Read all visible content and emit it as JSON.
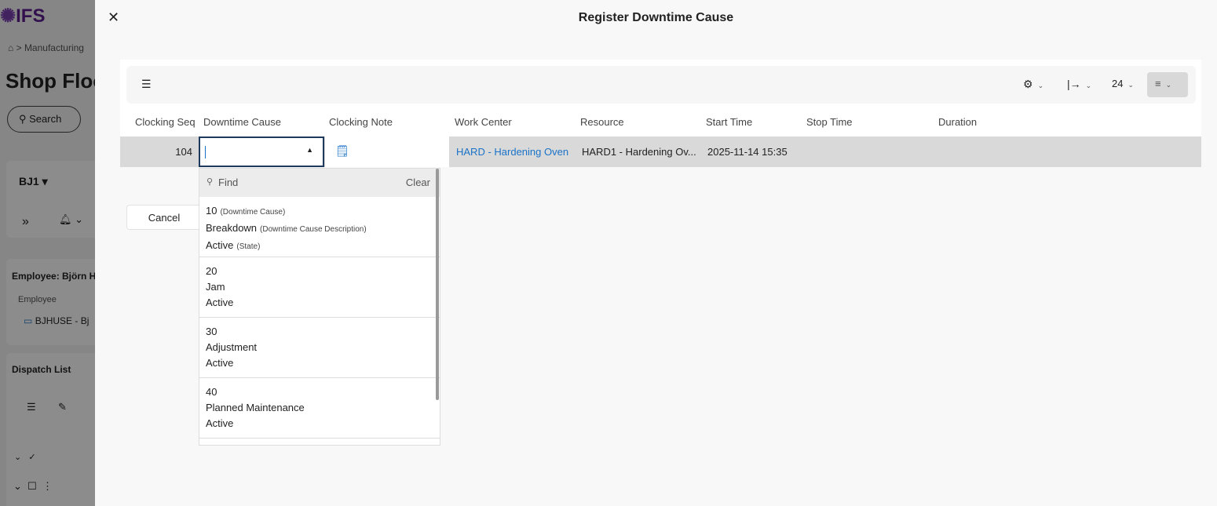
{
  "background": {
    "logo": "IFS",
    "breadcrumb": "Manufacturing",
    "page_title": "Shop Floor",
    "search_label": "Search",
    "resource": "BJ1",
    "employee_title": "Employee: Björn H",
    "employee_label": "Employee",
    "employee_value": "BJHUSE - Bj",
    "dispatch_title": "Dispatch List"
  },
  "modal": {
    "title": "Register Downtime Cause",
    "cancel_label": "Cancel",
    "toolbar": {
      "page_size": "24"
    },
    "columns": [
      "Clocking Seq",
      "Downtime Cause",
      "Clocking Note",
      "Work Center",
      "Resource",
      "Start Time",
      "Stop Time",
      "Duration"
    ],
    "row": {
      "clocking_seq": "104",
      "downtime_cause": "",
      "work_center": "HARD - Hardening Oven",
      "resource": "HARD1 - Hardening Ov...",
      "start_time": "2025-11-14 15:35",
      "stop_time": "",
      "duration": ""
    },
    "dropdown": {
      "find_placeholder": "Find",
      "clear_label": "Clear",
      "field_labels": {
        "code": "(Downtime Cause)",
        "description": "(Downtime Cause Description)",
        "state": "(State)"
      },
      "options": [
        {
          "code": "10",
          "description": "Breakdown",
          "state": "Active"
        },
        {
          "code": "20",
          "description": "Jam",
          "state": "Active"
        },
        {
          "code": "30",
          "description": "Adjustment",
          "state": "Active"
        },
        {
          "code": "40",
          "description": "Planned Maintenance",
          "state": "Active"
        }
      ]
    }
  }
}
